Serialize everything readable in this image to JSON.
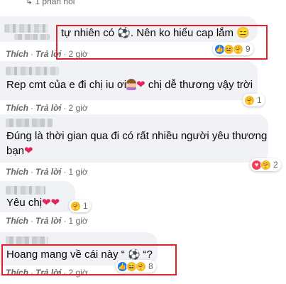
{
  "replies_link": "↳ 1 phản hồi",
  "actions": {
    "like": "Thích",
    "reply": "Trả lời",
    "separator": "·"
  },
  "comments": [
    {
      "text": "tự nhiên có ⚽. Nên ko hiểu cap lắm 😑",
      "time": "2 giờ",
      "reaction_count": "9",
      "reactions": [
        "like-icon",
        "haha-icon",
        "care-icon"
      ]
    },
    {
      "text_a": "Rep cmt của e đi chị iu ơi",
      "text_b": " chị dễ thương vậy trời",
      "time": "2 giờ",
      "reaction_count": "1",
      "reactions": [
        "care-icon"
      ]
    },
    {
      "line1": "Đúng là thời gian qua đi có rất nhiều người yêu thương",
      "line2": "bạn",
      "time": "1 giờ",
      "reaction_count": "2",
      "reactions": [
        "love-icon",
        "care-icon"
      ]
    },
    {
      "text": "Yêu chị",
      "time": "1 giờ",
      "reaction_count": "1",
      "reactions": [
        "care-icon"
      ]
    },
    {
      "text_a": "Hoang mang về cái này “ ",
      "text_b": " “?",
      "time": "2 giờ",
      "reaction_count": "8",
      "reactions": [
        "like-icon",
        "haha-icon",
        "care-icon"
      ]
    }
  ],
  "colors": {
    "bubble": "#f0f2f5",
    "highlight": "#e0202a",
    "like": "#1877f2",
    "love": "#f33e58",
    "care": "#f7b928"
  }
}
